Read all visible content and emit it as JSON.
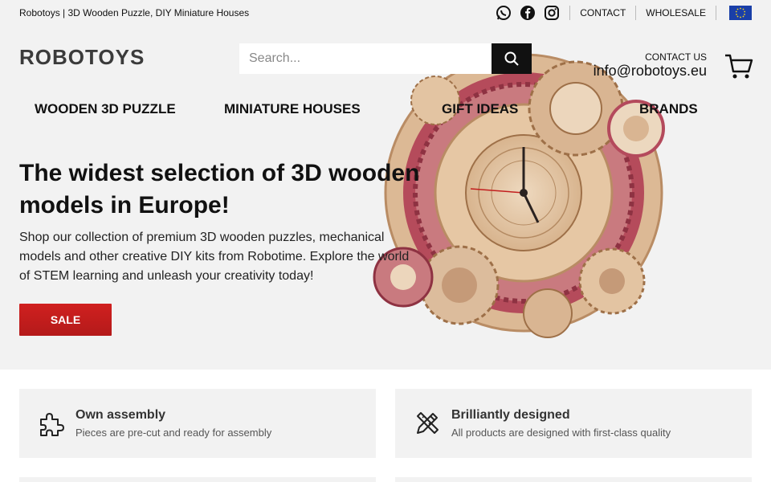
{
  "topbar": {
    "tagline": "Robotoys | 3D Wooden Puzzle, DIY Miniature Houses",
    "social_icons": [
      "whatsapp-icon",
      "facebook-icon",
      "instagram-icon"
    ],
    "contact_label": "CONTACT",
    "wholesale_label": "WHOLESALE",
    "flag_icon": "eu-flag-icon"
  },
  "header": {
    "logo": "ROBOTOYS",
    "search_placeholder": "Search...",
    "search_icon": "search-icon",
    "contact_us_label": "CONTACT US",
    "email": "info@robotoys.eu",
    "cart_icon": "cart-icon"
  },
  "nav": {
    "items": [
      "WOODEN 3D PUZZLE",
      "MINIATURE HOUSES",
      "GIFT IDEAS",
      "BRANDS"
    ]
  },
  "hero": {
    "title": "The widest selection of 3D wooden models in Europe!",
    "text": "Shop our collection of premium 3D wooden puzzles, mechanical models and other creative DIY kits from Robotime. Explore the world of STEM learning and unleash your creativity today!",
    "button_label": "SALE"
  },
  "features": [
    {
      "icon": "puzzle-icon",
      "title": "Own assembly",
      "subtitle": "Pieces are pre-cut and ready for assembly"
    },
    {
      "icon": "pencil-ruler-icon",
      "title": "Brilliantly designed",
      "subtitle": "All products are designed with first-class quality"
    }
  ],
  "colors": {
    "accent": "#c61e1e",
    "background": "#f2f2f2",
    "text": "#111111",
    "search_button": "#111111",
    "flag": "#1a3fa8"
  }
}
